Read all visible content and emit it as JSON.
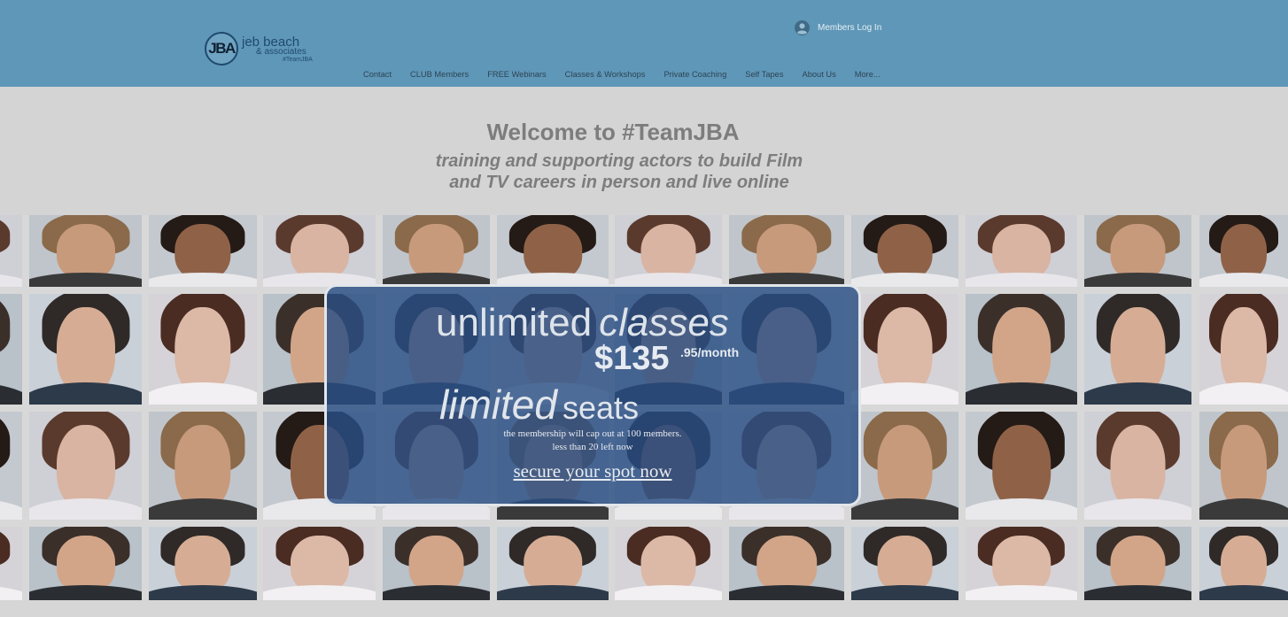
{
  "header": {
    "logo": {
      "mark": "JBA",
      "name": "jeb beach",
      "sub": "& associates",
      "tag": "#TeamJBA"
    },
    "login_label": "Members Log In",
    "nav": [
      "Contact",
      "CLUB Members",
      "FREE Webinars",
      "Classes & Workshops",
      "Private Coaching",
      "Self Tapes",
      "About Us",
      "More..."
    ]
  },
  "welcome": {
    "title": "Welcome to #TeamJBA",
    "subtitle_line1": "training and supporting actors to build Film",
    "subtitle_line2": "and TV careers in person and live online"
  },
  "promo": {
    "line1_a": "unlimited",
    "line1_b": "classes",
    "price": "$135",
    "price_suffix": ".95/month",
    "line3_a": "limited",
    "line3_b": "seats",
    "note1": "the membership will cap out at 100 members.",
    "note2": "less than 20 left now",
    "cta": "secure your spot now"
  },
  "colors": {
    "header_bg": "#5f97b8",
    "promo_bg": "#294e84",
    "page_bg": "#d4d4d4"
  }
}
